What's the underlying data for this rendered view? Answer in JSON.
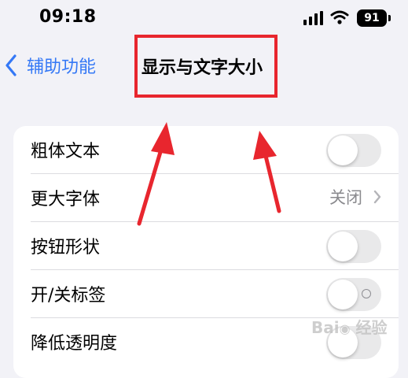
{
  "status_bar": {
    "time": "09:18",
    "battery": "91"
  },
  "nav": {
    "back_label": "辅助功能",
    "title": "显示与文字大小"
  },
  "rows": [
    {
      "label": "粗体文本",
      "control": "toggle",
      "on": false
    },
    {
      "label": "更大字体",
      "control": "detail",
      "value": "关闭"
    },
    {
      "label": "按钮形状",
      "control": "toggle",
      "on": false
    },
    {
      "label": "开/关标签",
      "control": "toggle",
      "on": false
    },
    {
      "label": "降低透明度",
      "control": "toggle",
      "on": false
    }
  ],
  "colors": {
    "accent": "#3478f6",
    "annotation": "#e8262e",
    "background": "#f2f2f7"
  },
  "icons": [
    "cellular-signal-icon",
    "wifi-icon",
    "battery-icon",
    "chevron-left-icon",
    "chevron-right-icon"
  ]
}
